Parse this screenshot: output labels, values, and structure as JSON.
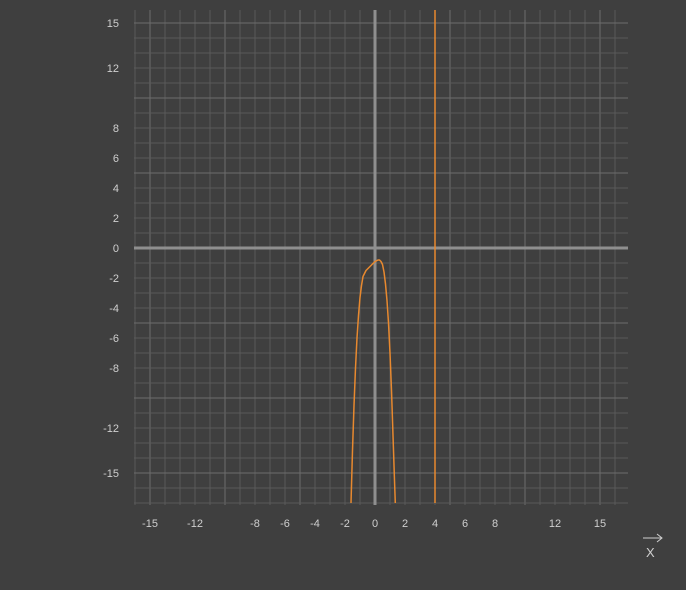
{
  "colors": {
    "background": "#3f3f3f",
    "grid_minor": "#5a5a5a",
    "grid_major": "#6c6c6c",
    "axis": "#8f8f8f",
    "tick_label": "#cfcfcf",
    "curve": "#e8892f"
  },
  "x_arrow_label": "X",
  "chart_data": {
    "type": "line",
    "grid": true,
    "xlim": [
      -16,
      17
    ],
    "ylim": [
      -17,
      16
    ],
    "x_ticks": [
      -15,
      -12,
      -8,
      -6,
      -4,
      -2,
      0,
      2,
      4,
      6,
      8,
      12,
      15
    ],
    "x_tick_labels": [
      "-15",
      "-12",
      "-8",
      "-6",
      "-4",
      "-2",
      "0",
      "2",
      "4",
      "6",
      "8",
      "12",
      "15"
    ],
    "y_ticks": [
      15,
      12,
      8,
      6,
      4,
      2,
      0,
      -2,
      -4,
      -6,
      -8,
      -12,
      -15
    ],
    "y_tick_labels": [
      "15",
      "12",
      "8",
      "6",
      "4",
      "2",
      "0",
      "-2",
      "-4",
      "-6",
      "-8",
      "-12",
      "-15"
    ],
    "series": [
      {
        "points": [
          [
            -1.6,
            -17
          ],
          [
            -1.5,
            -13.5
          ],
          [
            -1.4,
            -10.5
          ],
          [
            -1.3,
            -8
          ],
          [
            -1.2,
            -6
          ],
          [
            -1.1,
            -4.5
          ],
          [
            -1.0,
            -3.3
          ],
          [
            -0.9,
            -2.5
          ],
          [
            -0.8,
            -1.9
          ],
          [
            -0.6,
            -1.5
          ],
          [
            -0.4,
            -1.3
          ],
          [
            -0.2,
            -1.1
          ],
          [
            0.0,
            -0.9
          ],
          [
            0.1,
            -0.85
          ],
          [
            0.2,
            -0.8
          ],
          [
            0.3,
            -0.8
          ],
          [
            0.4,
            -0.9
          ],
          [
            0.5,
            -1.1
          ],
          [
            0.6,
            -1.6
          ],
          [
            0.7,
            -2.4
          ],
          [
            0.8,
            -3.5
          ],
          [
            0.9,
            -5.0
          ],
          [
            1.0,
            -7.0
          ],
          [
            1.1,
            -9.5
          ],
          [
            1.2,
            -12.5
          ],
          [
            1.3,
            -15.5
          ],
          [
            1.35,
            -17
          ]
        ]
      },
      {
        "points": [
          [
            4,
            -17
          ],
          [
            4,
            16
          ]
        ]
      }
    ]
  }
}
